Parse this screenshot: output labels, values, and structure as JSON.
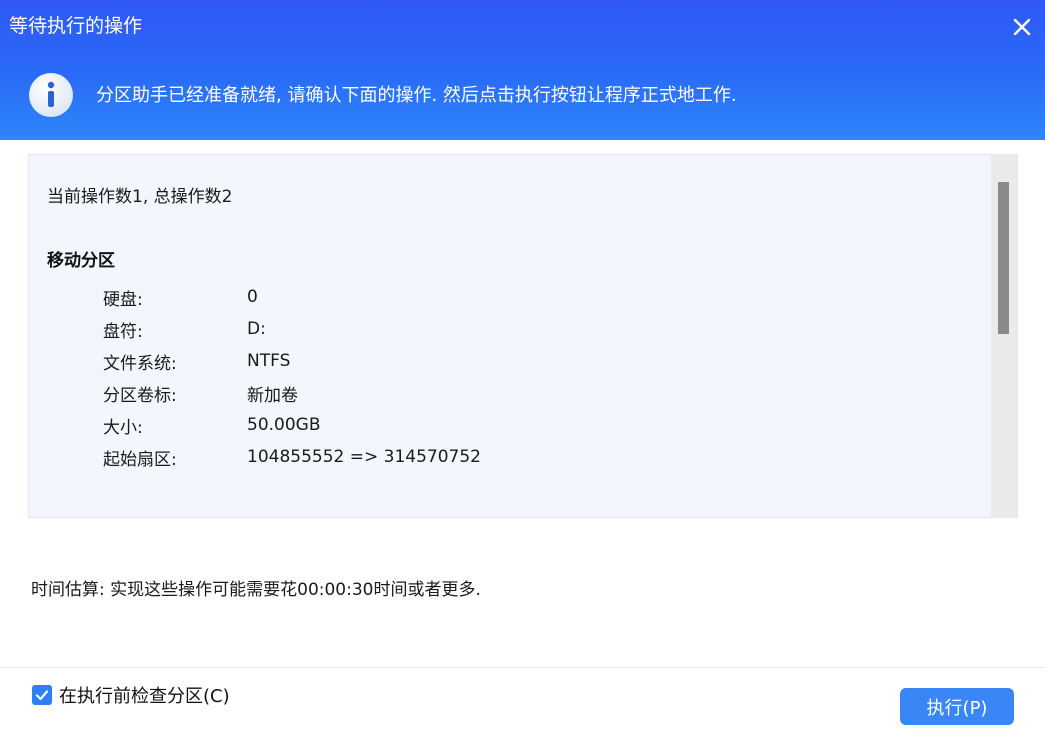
{
  "window": {
    "title": "等待执行的操作",
    "close_icon": "close-icon"
  },
  "banner": {
    "icon": "info-icon",
    "message": "分区助手已经准备就绪, 请确认下面的操作. 然后点击执行按钮让程序正式地工作."
  },
  "operations": {
    "summary": "当前操作数1, 总操作数2",
    "title": "移动分区",
    "rows": [
      {
        "label": "硬盘:",
        "value": "0"
      },
      {
        "label": "盘符:",
        "value": "D:"
      },
      {
        "label": "文件系统:",
        "value": "NTFS"
      },
      {
        "label": "分区卷标:",
        "value": "新加卷"
      },
      {
        "label": "大小:",
        "value": "50.00GB"
      },
      {
        "label": "起始扇区:",
        "value": "104855552 => 314570752"
      }
    ]
  },
  "estimate": "时间估算: 实现这些操作可能需要花00:00:30时间或者更多.",
  "footer": {
    "check_label": "在执行前检查分区(C)",
    "checked": true,
    "execute_label": "执行(P)"
  },
  "colors": {
    "header_top": "#2f58f6",
    "header_bottom": "#2f86fb",
    "accent": "#3b86f7",
    "ops_bg": "#f3f6fd"
  }
}
